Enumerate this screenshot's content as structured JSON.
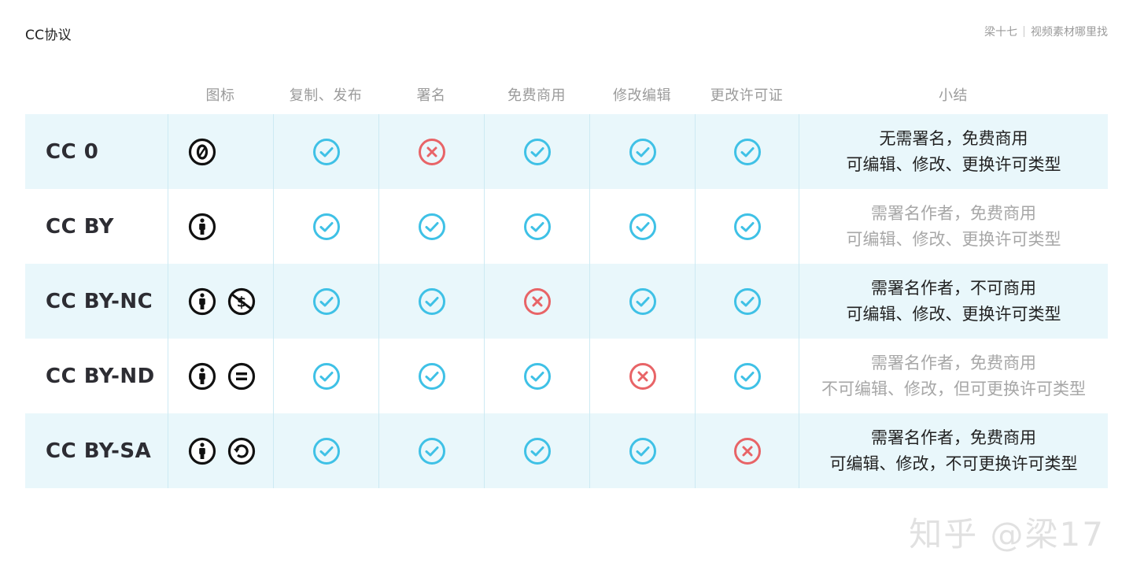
{
  "title": "CC协议",
  "top_right": {
    "author": "梁十七",
    "subtitle": "视频素材哪里找"
  },
  "columns": [
    "",
    "图标",
    "复制、发布",
    "署名",
    "免费商用",
    "修改编辑",
    "更改许可证",
    "小结"
  ],
  "colors": {
    "check": "#3fc1e6",
    "cross": "#e86467",
    "row_shade": "#e9f7fb"
  },
  "rows": [
    {
      "name": "CC 0",
      "icons": [
        "cc-zero-icon"
      ],
      "values": [
        true,
        false,
        true,
        true,
        true
      ],
      "summary": [
        "无需署名，免费商用",
        "可编辑、修改、更换许可类型"
      ],
      "muted": false,
      "shaded": true
    },
    {
      "name": "CC BY",
      "icons": [
        "cc-by-attribution-icon"
      ],
      "values": [
        true,
        true,
        true,
        true,
        true
      ],
      "summary": [
        "需署名作者，免费商用",
        "可编辑、修改、更换许可类型"
      ],
      "muted": true,
      "shaded": false
    },
    {
      "name": "CC BY-NC",
      "icons": [
        "cc-by-attribution-icon",
        "cc-nc-noncommercial-icon"
      ],
      "values": [
        true,
        true,
        false,
        true,
        true
      ],
      "summary": [
        "需署名作者，不可商用",
        "可编辑、修改、更换许可类型"
      ],
      "muted": false,
      "shaded": true
    },
    {
      "name": "CC BY-ND",
      "icons": [
        "cc-by-attribution-icon",
        "cc-nd-noderivatives-icon"
      ],
      "values": [
        true,
        true,
        true,
        false,
        true
      ],
      "summary": [
        "需署名作者，免费商用",
        "不可编辑、修改，但可更换许可类型"
      ],
      "muted": true,
      "shaded": false
    },
    {
      "name": "CC BY-SA",
      "icons": [
        "cc-by-attribution-icon",
        "cc-sa-sharealike-icon"
      ],
      "values": [
        true,
        true,
        true,
        true,
        false
      ],
      "summary": [
        "需署名作者，免费商用",
        "可编辑、修改，不可更换许可类型"
      ],
      "muted": false,
      "shaded": true
    }
  ],
  "watermark": "知乎 @梁17"
}
